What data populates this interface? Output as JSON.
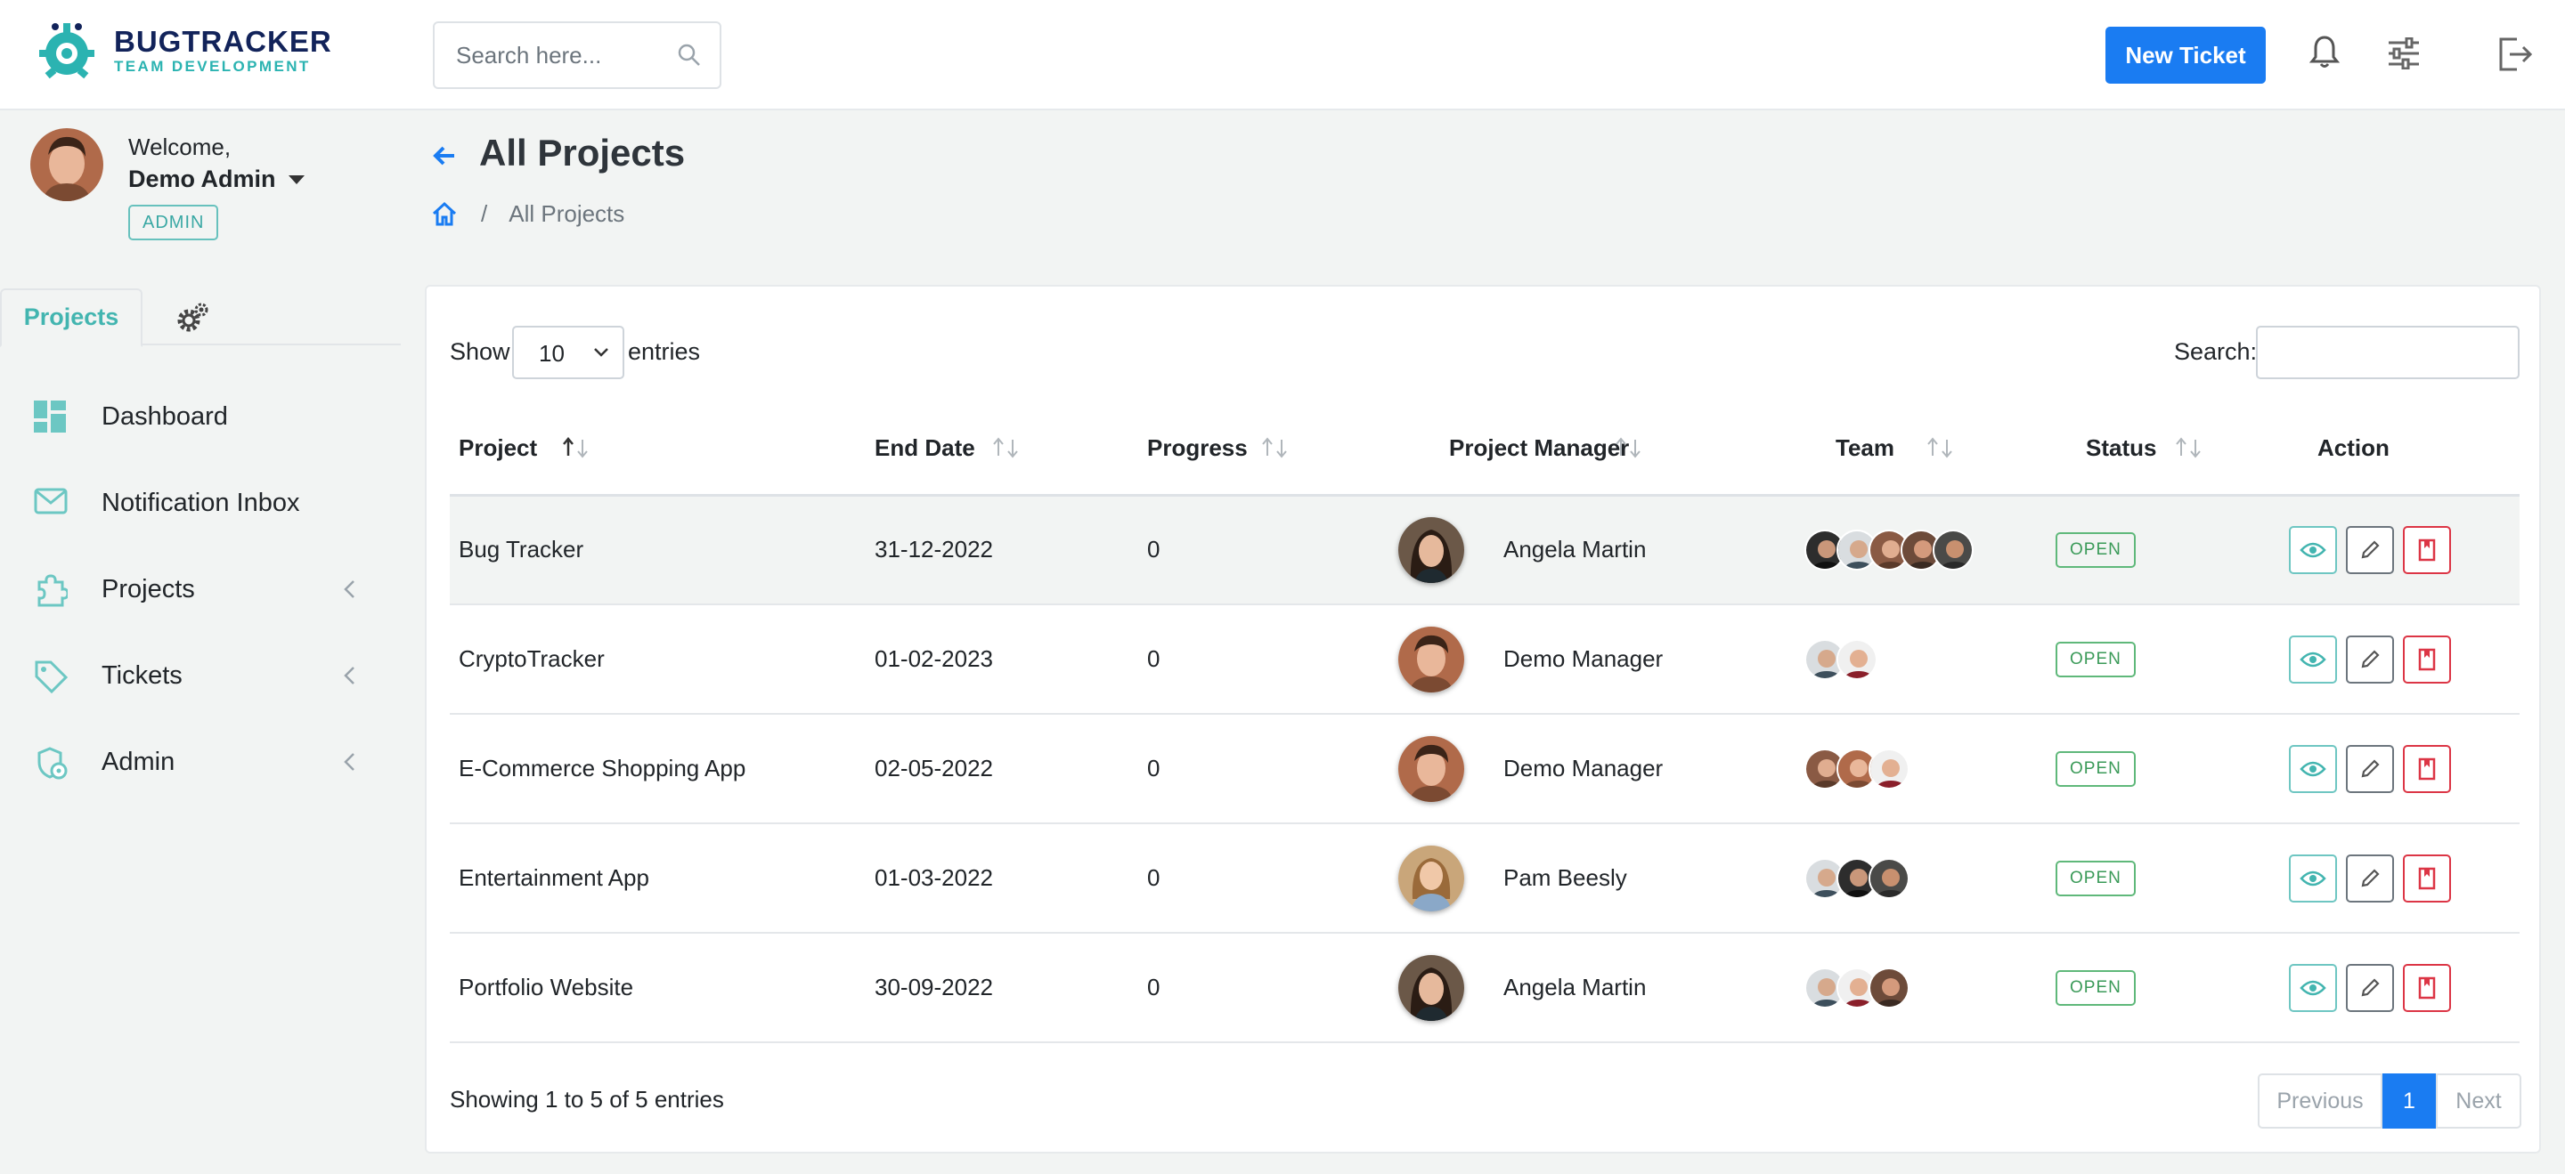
{
  "brand": {
    "title": "BUGTRACKER",
    "subtitle": "TEAM DEVELOPMENT",
    "accent": "#2bb3b1",
    "navy": "#12235a"
  },
  "header": {
    "search_placeholder": "Search here...",
    "new_ticket_label": "New Ticket",
    "icons": [
      "bell-icon",
      "sliders-icon",
      "logout-icon"
    ]
  },
  "user": {
    "welcome": "Welcome,",
    "name": "Demo Admin",
    "role": "ADMIN"
  },
  "sidebar": {
    "tab_label": "Projects",
    "items": [
      {
        "label": "Dashboard",
        "icon": "dashboard-icon"
      },
      {
        "label": "Notification Inbox",
        "icon": "mail-icon"
      },
      {
        "label": "Projects",
        "icon": "puzzle-icon"
      },
      {
        "label": "Tickets",
        "icon": "tag-icon"
      },
      {
        "label": "Admin",
        "icon": "user-gear-icon"
      }
    ]
  },
  "page": {
    "title": "All Projects",
    "breadcrumb_current": "All Projects"
  },
  "table": {
    "show_label": "Show",
    "entries_value": "10",
    "entries_label": "entries",
    "search_label": "Search:",
    "columns": [
      "Project",
      "End Date",
      "Progress",
      "Project Manager",
      "Team",
      "Status",
      "Action"
    ],
    "rows": [
      {
        "project": "Bug Tracker",
        "end_date": "31-12-2022",
        "progress": "0",
        "manager": "Angela Martin",
        "status": "OPEN"
      },
      {
        "project": "CryptoTracker",
        "end_date": "01-02-2023",
        "progress": "0",
        "manager": "Demo Manager",
        "status": "OPEN"
      },
      {
        "project": "E-Commerce Shopping App",
        "end_date": "02-05-2022",
        "progress": "0",
        "manager": "Demo Manager",
        "status": "OPEN"
      },
      {
        "project": "Entertainment App",
        "end_date": "01-03-2022",
        "progress": "0",
        "manager": "Pam Beesly",
        "status": "OPEN"
      },
      {
        "project": "Portfolio Website",
        "end_date": "30-09-2022",
        "progress": "0",
        "manager": "Angela Martin",
        "status": "OPEN"
      }
    ],
    "info": "Showing 1 to 5 of 5 entries",
    "pager": {
      "prev": "Previous",
      "current": "1",
      "next": "Next"
    }
  },
  "colors": {
    "primary": "#1a7cf2",
    "teal": "#43b5b0",
    "status_green": "#3a9a58",
    "danger": "#dc3545"
  }
}
